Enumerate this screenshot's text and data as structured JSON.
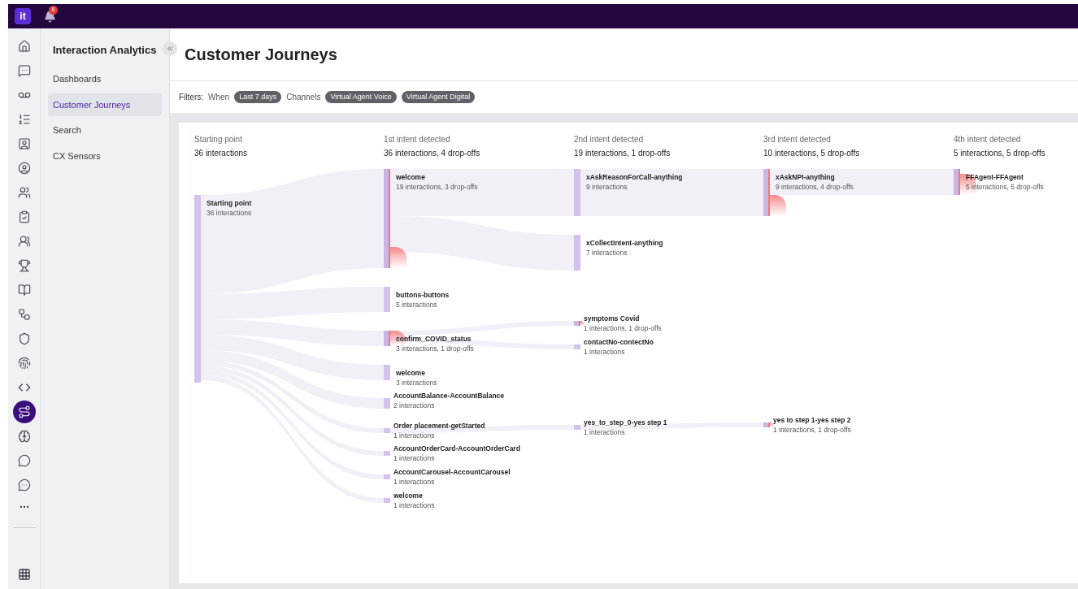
{
  "topbar": {
    "logo": "it",
    "notifications": "6"
  },
  "rail": [
    {
      "selected": false
    },
    {
      "selected": false
    },
    {
      "selected": false
    },
    {
      "selected": false
    },
    {
      "selected": false
    },
    {
      "selected": false
    },
    {
      "selected": false
    },
    {
      "selected": false
    },
    {
      "selected": false
    },
    {
      "selected": false
    },
    {
      "selected": false
    },
    {
      "selected": false
    },
    {
      "selected": false
    },
    {
      "selected": false
    },
    {
      "selected": false
    },
    {
      "selected": true
    },
    {
      "selected": false
    },
    {
      "selected": false
    },
    {
      "selected": false
    }
  ],
  "sidebar": {
    "title": "Interaction Analytics",
    "items": [
      {
        "label": "Dashboards",
        "selected": false
      },
      {
        "label": "Customer Journeys",
        "selected": true
      },
      {
        "label": "Search",
        "selected": false
      },
      {
        "label": "CX Sensors",
        "selected": false
      }
    ]
  },
  "page": {
    "title": "Customer Journeys"
  },
  "filters": {
    "label": "Filters:",
    "groups": [
      {
        "name": "When",
        "chips": [
          "Last 7 days"
        ]
      },
      {
        "name": "Channels",
        "chips": [
          "Virtual Agent Voice",
          "Virtual Agent Digital"
        ]
      }
    ]
  },
  "columns": [
    {
      "title": "Starting point",
      "summary": "36 interactions",
      "nodes": [
        {
          "name": "Starting point",
          "stats": "36 interactions",
          "drop_off": false
        }
      ]
    },
    {
      "title": "1st intent detected",
      "summary": "36 interactions, 4 drop-offs",
      "nodes": [
        {
          "name": "welcome",
          "stats": "19 interactions, 3 drop-offs",
          "drop_off": true
        },
        {
          "name": "buttons-buttons",
          "stats": "5 interactions",
          "drop_off": false
        },
        {
          "name": "confirm_COVID_status",
          "stats": "3 interactions, 1 drop-offs",
          "drop_off": true
        },
        {
          "name": "welcome",
          "stats": "3 interactions",
          "drop_off": false
        },
        {
          "name": "AccountBalance-AccountBalance",
          "stats": "2 interactions",
          "drop_off": false
        },
        {
          "name": "Order placement-getStarted",
          "stats": "1 interactions",
          "drop_off": false
        },
        {
          "name": "AccountOrderCard-AccountOrderCard",
          "stats": "1 interactions",
          "drop_off": false
        },
        {
          "name": "AccountCarousel-AccountCarousel",
          "stats": "1 interactions",
          "drop_off": false
        },
        {
          "name": "welcome",
          "stats": "1 interactions",
          "drop_off": false
        }
      ]
    },
    {
      "title": "2nd intent detected",
      "summary": "19 interactions, 1 drop-offs",
      "nodes": [
        {
          "name": "xAskReasonForCall-anything",
          "stats": "9 interactions",
          "drop_off": false
        },
        {
          "name": "xCollectIntent-anything",
          "stats": "7 interactions",
          "drop_off": false
        },
        {
          "name": "symptoms Covid",
          "stats": "1 interactions, 1 drop-offs",
          "drop_off": true
        },
        {
          "name": "contactNo-contectNo",
          "stats": "1 interactions",
          "drop_off": false
        },
        {
          "name": "yes_to_step_0-yes step 1",
          "stats": "1 interactions",
          "drop_off": false
        }
      ]
    },
    {
      "title": "3rd intent detected",
      "summary": "10 interactions, 5 drop-offs",
      "nodes": [
        {
          "name": "xAskNPI-anything",
          "stats": "9 interactions, 4 drop-offs",
          "drop_off": true
        },
        {
          "name": "yes to step 1-yes step 2",
          "stats": "1 interactions, 1 drop-offs",
          "drop_off": true
        }
      ]
    },
    {
      "title": "4th intent detected",
      "summary": "5 interactions, 5 drop-offs",
      "nodes": [
        {
          "name": "FFAgent-FFAgent",
          "stats": "5 interactions, 5 drop-offs",
          "drop_off": true
        }
      ]
    }
  ]
}
